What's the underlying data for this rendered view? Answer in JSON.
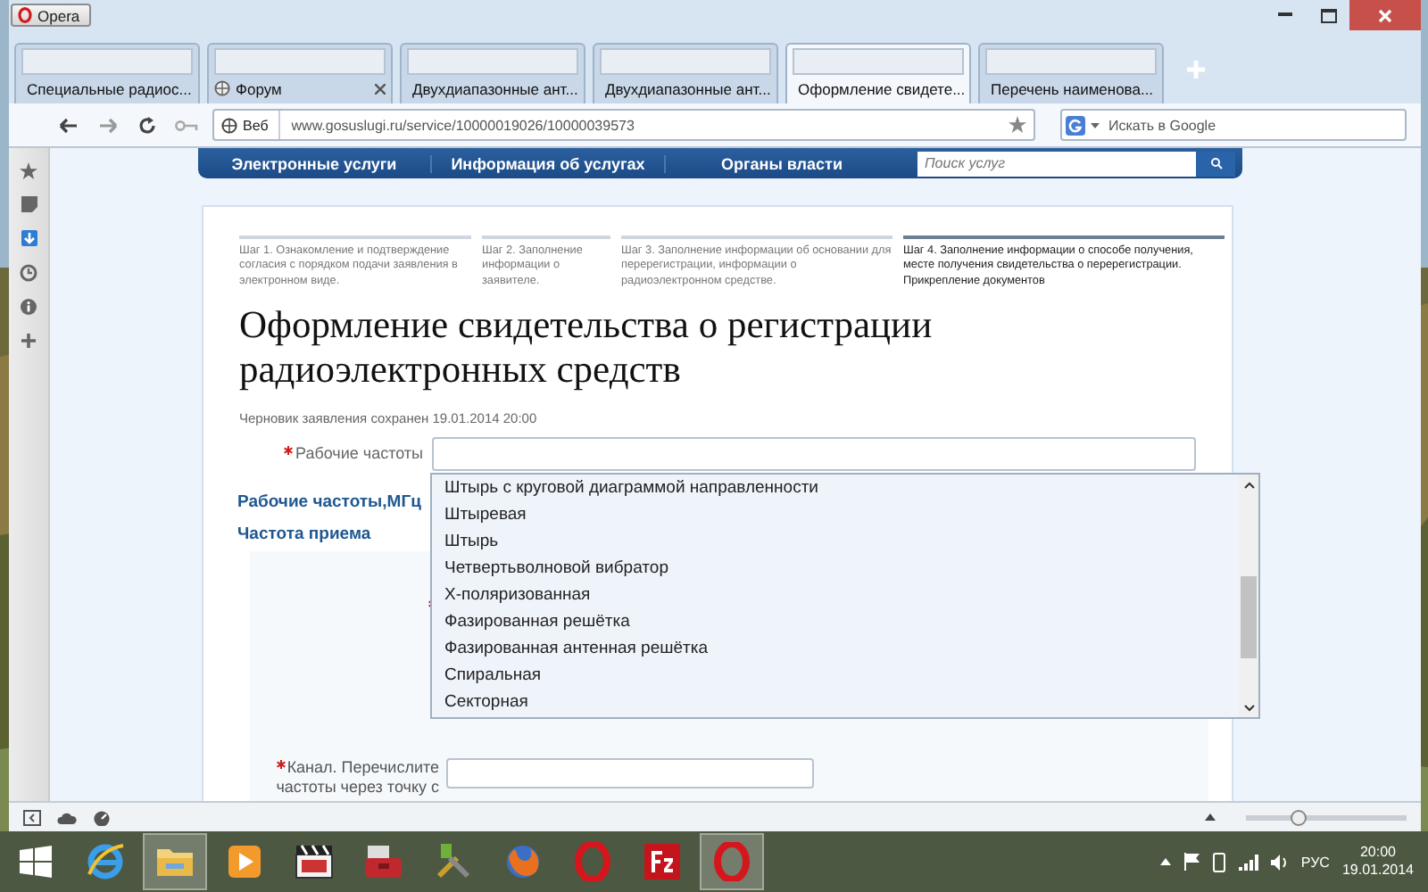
{
  "browser": {
    "menu_button": "Opera",
    "tabs": [
      {
        "label": "Специальные радиос...",
        "selected": false
      },
      {
        "label": "Форум",
        "selected": false
      },
      {
        "label": "Двухдиапазонные ант...",
        "selected": false
      },
      {
        "label": "Двухдиапазонные ант...",
        "selected": false
      },
      {
        "label": "Оформление свидете...",
        "selected": true
      },
      {
        "label": "Перечень наименова...",
        "selected": false
      }
    ],
    "address": {
      "badge": "Веб",
      "url": "www.gosuslugi.ru/service/10000019026/10000039573",
      "search_placeholder": "Искать в Google"
    }
  },
  "site_nav": {
    "items": [
      "Электронные услуги",
      "Информация об услугах",
      "Органы власти"
    ],
    "search_placeholder": "Поиск услуг"
  },
  "steps": [
    {
      "text": "Шаг 1. Ознакомление и подтверждение согласия с порядком подачи заявления в электронном виде.",
      "selected": false
    },
    {
      "text": "Шаг 2. Заполнение информации о заявителе.",
      "selected": false
    },
    {
      "text": "Шаг 3. Заполнение информации об основании для перерегистрации, информации о радиоэлектронном средстве.",
      "selected": false
    },
    {
      "text": "Шаг 4. Заполнение информации о способе получения, месте получения свидетельства о перерегистрации. Прикрепление документов",
      "selected": true
    }
  ],
  "title": "Оформление свидетельства о регистрации радиоэлектронных средств",
  "draft_note": "Черновик заявления сохранен 19.01.2014 20:00",
  "form": {
    "frequency_field": {
      "label": "Рабочие частоты",
      "required": true
    },
    "section_heading": "Рабочие частоты,МГц",
    "subheading": "Частота приема",
    "panel_fields": [
      {
        "required": true
      },
      {
        "label": "Канал. Перечислите частоты через точку с",
        "required": true
      }
    ]
  },
  "dropdown": {
    "options": [
      "Штырь с круговой диаграммой направленности",
      "Штыревая",
      "Штырь",
      "Четвертьволновой вибратор",
      "X-поляризованная",
      "Фазированная решётка",
      "Фазированная антенная решётка",
      "Спиральная",
      "Секторная"
    ]
  },
  "zoom_slider": {
    "level": 0.3
  },
  "taskbar": {
    "apps": [
      {
        "kind": "start",
        "active": false
      },
      {
        "kind": "ie",
        "active": false
      },
      {
        "kind": "explorer",
        "active": true
      },
      {
        "kind": "media",
        "active": false
      },
      {
        "kind": "player321",
        "active": false
      },
      {
        "kind": "toolbox",
        "active": false
      },
      {
        "kind": "tools",
        "active": false
      },
      {
        "kind": "firefox",
        "active": false
      },
      {
        "kind": "opera",
        "active": false
      },
      {
        "kind": "filezilla",
        "active": false
      },
      {
        "kind": "opera",
        "active": true
      }
    ],
    "language": "РУС",
    "time": "20:00",
    "date": "19.01.2014"
  }
}
